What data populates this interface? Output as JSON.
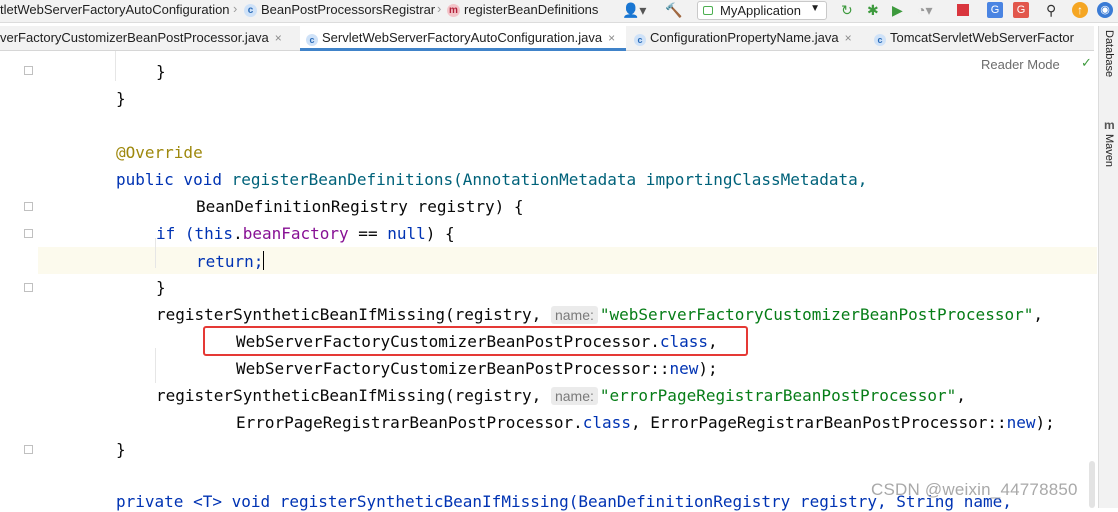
{
  "navbar": {
    "crumbs": [
      "tletWebServerFactoryAutoConfiguration",
      "BeanPostProcessorsRegistrar",
      "registerBeanDefinitions"
    ],
    "run_config": "MyApplication",
    "accent": "#4083c9"
  },
  "tabs": [
    "verFactoryCustomizerBeanPostProcessor.java",
    "ServletWebServerFactoryAutoConfiguration.java",
    "ConfigurationPropertyName.java",
    "TomcatServletWebServerFactor"
  ],
  "active_tab_index": 1,
  "side_panels": [
    "Database",
    "Maven"
  ],
  "editor": {
    "reader_mode": "Reader Mode",
    "hint_name": "name:",
    "watermark": "CSDN @weixin_44778850",
    "lines": {
      "l1": "}",
      "l2": "}",
      "l3": "@Override",
      "l4a": "public void ",
      "l4b": "registerBeanDefinitions(AnnotationMetadata importingClassMetadata,",
      "l5": "BeanDefinitionRegistry registry) {",
      "l6a": "if (",
      "l6b": "this",
      "l6c": ".",
      "l6d": "beanFactory",
      "l6e": " == ",
      "l6f": "null",
      "l6g": ") {",
      "l7": "return;",
      "l8": "}",
      "l9a": "registerSyntheticBeanIfMissing(registry, ",
      "l9b": "\"webServerFactoryCustomizerBeanPostProcessor\"",
      "l9c": ",",
      "l10a": "WebServerFactoryCustomizerBeanPostProcessor.",
      "l10b": "class",
      "l10c": ",",
      "l11a": "WebServerFactoryCustomizerBeanPostProcessor::",
      "l11b": "new",
      "l11c": ");",
      "l12a": "registerSyntheticBeanIfMissing(registry, ",
      "l12b": "\"errorPageRegistrarBeanPostProcessor\"",
      "l12c": ",",
      "l13a": "ErrorPageRegistrarBeanPostProcessor.",
      "l13b": "class",
      "l13c": ", ErrorPageRegistrarBeanPostProcessor::",
      "l13d": "new",
      "l13e": ");",
      "l14": "}",
      "l15": "private <T> void registerSyntheticBeanIfMissing(BeanDefinitionRegistry registry, String name,"
    }
  }
}
